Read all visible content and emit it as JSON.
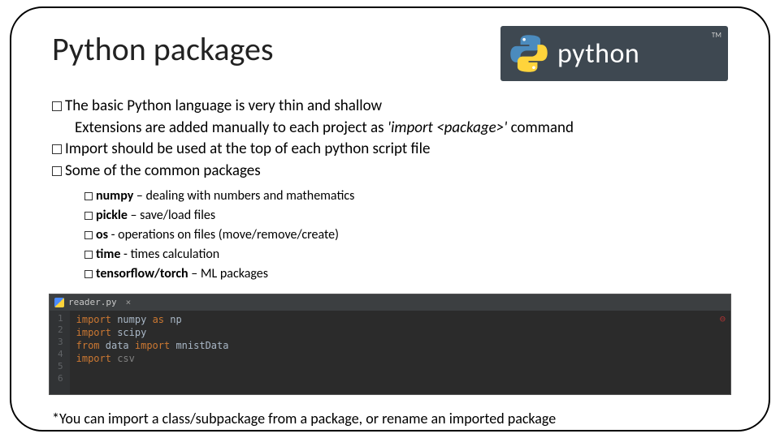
{
  "title": "Python packages",
  "logo": {
    "text": "python",
    "tm": "TM"
  },
  "bullets": {
    "b1": "The basic Python language is very thin and shallow",
    "b1sub": "Extensions are added manually to each project as ",
    "b1sub_ital": "'import <package>'",
    "b1sub_tail": " command",
    "b2": "Import should be used at the top of each python script file",
    "b3": "Some of the common packages"
  },
  "packages": [
    {
      "name": "numpy",
      "sep": " – ",
      "desc": "dealing with numbers and mathematics"
    },
    {
      "name": "pickle",
      "sep": " – ",
      "desc": "save/load files"
    },
    {
      "name": "os",
      "sep": "  - ",
      "desc": "operations on files (move/remove/create)"
    },
    {
      "name": "time",
      "sep": "  - ",
      "desc": "times calculation"
    },
    {
      "name": "tensorflow/torch",
      "sep": " – ",
      "desc": "ML packages"
    }
  ],
  "code": {
    "tab": "reader.py",
    "close": "×",
    "lines": [
      "1",
      "2",
      "3",
      "4",
      "5",
      "6"
    ],
    "line1_a": "import ",
    "line1_b": "numpy ",
    "line1_c": "as ",
    "line1_d": "np",
    "line2_a": "import ",
    "line2_b": "scipy",
    "line3_a": "from ",
    "line3_b": "data ",
    "line3_c": "import ",
    "line3_d": "mnistData",
    "line4_a": "import ",
    "line4_b": "csv",
    "err": "⊖"
  },
  "footnote": "*You can import a class/subpackage from a package, or rename an imported package"
}
